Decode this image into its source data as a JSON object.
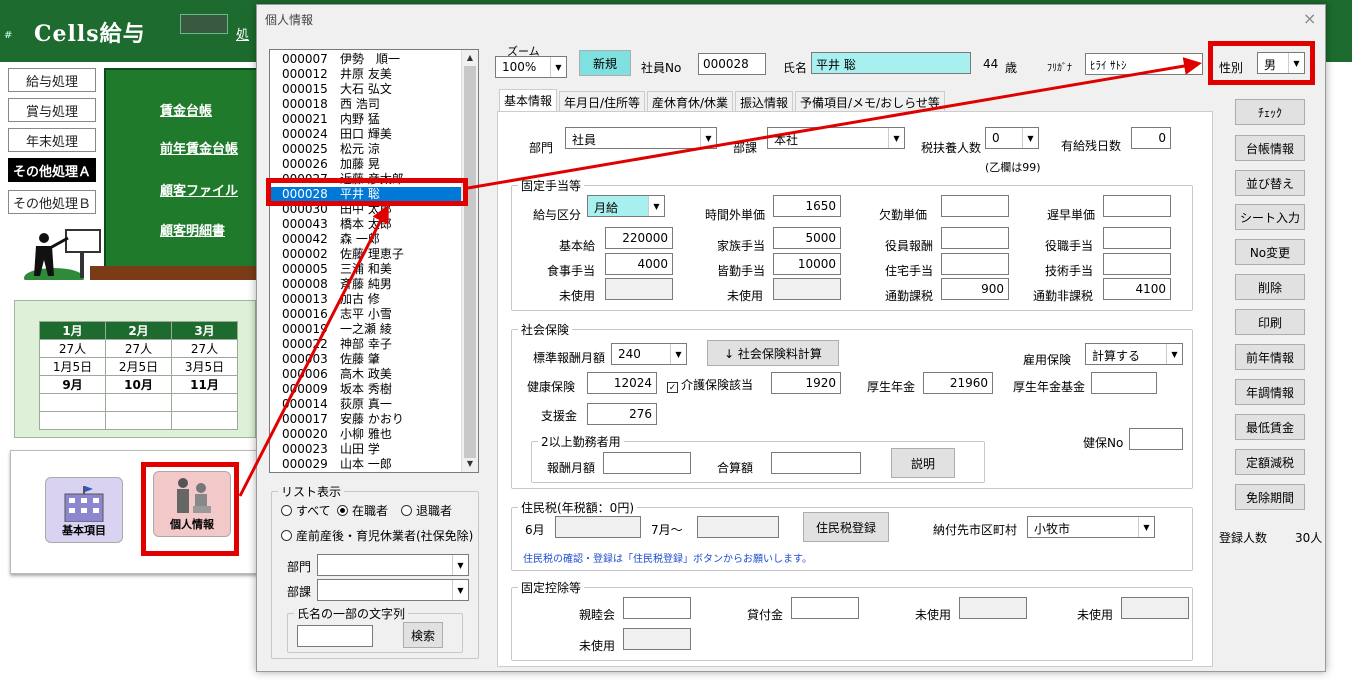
{
  "app": {
    "hash": "#",
    "title": "Cells給与",
    "header_link": "処",
    "side_menu": [
      "給与処理",
      "賞与処理",
      "年末処理",
      "その他処理Ａ",
      "その他処理Ｂ"
    ],
    "green_links": [
      "賃金台帳",
      "前年賃金台帳",
      "顧客ファイル",
      "顧客明細書"
    ],
    "months": {
      "headers": [
        "1月",
        "2月",
        "3月"
      ],
      "counts": [
        "27人",
        "27人",
        "27人"
      ],
      "dates": [
        "1月5日",
        "2月5日",
        "3月5日"
      ],
      "months2": [
        "9月",
        "10月",
        "11月"
      ]
    },
    "icons": {
      "kihon": "基本項目",
      "kojin": "個人情報"
    }
  },
  "dialog": {
    "title": "個人情報",
    "close": "×",
    "employees": [
      {
        "no": "000007",
        "name": "伊勢　順一"
      },
      {
        "no": "000012",
        "name": "井原 友美"
      },
      {
        "no": "000015",
        "name": "大石 弘文"
      },
      {
        "no": "000018",
        "name": "西 浩司"
      },
      {
        "no": "000021",
        "name": "内野 猛"
      },
      {
        "no": "000024",
        "name": "田口 輝美"
      },
      {
        "no": "000025",
        "name": "松元 涼"
      },
      {
        "no": "000026",
        "name": "加藤 晃"
      },
      {
        "no": "000027",
        "name": "近藤 彦太郎"
      },
      {
        "no": "000028",
        "name": "平井 聡"
      },
      {
        "no": "000030",
        "name": "田中 太郎"
      },
      {
        "no": "000043",
        "name": "橋本 太郎"
      },
      {
        "no": "000042",
        "name": "森 一郎"
      },
      {
        "no": "000002",
        "name": "佐藤 理恵子"
      },
      {
        "no": "000005",
        "name": "三浦 和美"
      },
      {
        "no": "000008",
        "name": "斉藤 純男"
      },
      {
        "no": "000013",
        "name": "加古 修"
      },
      {
        "no": "000016",
        "name": "志平 小雪"
      },
      {
        "no": "000019",
        "name": "一之瀬 綾"
      },
      {
        "no": "000022",
        "name": "神部 幸子"
      },
      {
        "no": "000003",
        "name": "佐藤 肇"
      },
      {
        "no": "000006",
        "name": "高木 政美"
      },
      {
        "no": "000009",
        "name": "坂本 秀樹"
      },
      {
        "no": "000014",
        "name": "荻原 真一"
      },
      {
        "no": "000017",
        "name": "安藤 かおり"
      },
      {
        "no": "000020",
        "name": "小柳 雅也"
      },
      {
        "no": "000023",
        "name": "山田 学"
      },
      {
        "no": "000029",
        "name": "山本 一郎"
      }
    ],
    "list_filter": {
      "legend": "リスト表示",
      "all": "すべて",
      "active": "在職者",
      "retired": "退職者",
      "maternity": "産前産後・育児休業者(社保免除)",
      "dept_label": "部門",
      "section_label": "部課",
      "name_part_legend": "氏名の一部の文字列",
      "search_button": "検索"
    },
    "header": {
      "zoom_label": "ズーム",
      "zoom_value": "100%",
      "new_button": "新規",
      "emp_no_label": "社員No",
      "emp_no": "000028",
      "name_label": "氏名",
      "name": "平井 聡",
      "age": "44",
      "age_unit": "歳",
      "kana_label": "ﾌﾘｶﾞﾅ",
      "kana": "ﾋﾗｲ ｻﾄｼ",
      "gender_label": "性別",
      "gender": "男"
    },
    "tabs": [
      "基本情報",
      "年月日/住所等",
      "産休育休/休業",
      "振込情報",
      "予備項目/メモ/おしらせ等"
    ],
    "basic": {
      "dept_label": "部門",
      "dept": "社員",
      "section_label": "部課",
      "section": "本社",
      "dependents_label": "税扶養人数",
      "dependents": "0",
      "dependents_note": "(乙欄は99)",
      "paid_leave_label": "有給残日数",
      "paid_leave": "0"
    },
    "fixed_allowance": {
      "legend": "固定手当等",
      "pay_type_label": "給与区分",
      "pay_type": "月給",
      "overtime_label": "時間外単価",
      "overtime": "1650",
      "absence_label": "欠勤単価",
      "absence": "",
      "late_label": "遅早単価",
      "late": "",
      "base_label": "基本給",
      "base": "220000",
      "family_label": "家族手当",
      "family": "5000",
      "officer_label": "役員報酬",
      "officer": "",
      "position_label": "役職手当",
      "position": "",
      "meal_label": "食事手当",
      "meal": "4000",
      "attendance_label": "皆勤手当",
      "attendance": "10000",
      "housing_label": "住宅手当",
      "housing": "",
      "skill_label": "技術手当",
      "skill": "",
      "unused1_label": "未使用",
      "unused2_label": "未使用",
      "commute_tax_label": "通勤課税",
      "commute_tax": "900",
      "commute_nontax_label": "通勤非課税",
      "commute_nontax": "4100"
    },
    "social": {
      "legend": "社会保険",
      "std_label": "標準報酬月額",
      "std": "240",
      "calc_button": "↓  社会保険料計算",
      "emp_ins_label": "雇用保険",
      "emp_ins": "計算する",
      "health_label": "健康保険",
      "health": "12024",
      "care_label": "介護保険該当",
      "care": "1920",
      "pension_label": "厚生年金",
      "pension": "21960",
      "pension_fund_label": "厚生年金基金",
      "pension_fund": "",
      "support_label": "支援金",
      "support": "276",
      "multi_legend": "2以上勤務者用",
      "remun_label": "報酬月額",
      "remun": "",
      "total_label": "合算額",
      "total": "",
      "explain_button": "説明",
      "health_no_label": "健保No",
      "health_no": ""
    },
    "resident": {
      "legend": "住民税(年税額：0円)",
      "june_label": "6月",
      "june": "",
      "july_label": "7月～",
      "july": "",
      "register_button": "住民税登録",
      "city_label": "納付先市区町村",
      "city": "小牧市",
      "note": "住民税の確認・登録は「住民税登録」ボタンからお願いします。"
    },
    "deduction": {
      "legend": "固定控除等",
      "social_label": "親睦会",
      "social": "",
      "loan_label": "貸付金",
      "loan": "",
      "unused1_label": "未使用",
      "unused2_label": "未使用",
      "unused3_label": "未使用"
    },
    "side_buttons": [
      "ﾁｪｯｸ",
      "台帳情報",
      "並び替え",
      "シート入力",
      "No変更",
      "削除",
      "印刷",
      "前年情報",
      "年調情報",
      "最低賃金",
      "定額減税",
      "免除期間"
    ],
    "registered_label": "登録人数",
    "registered_count": "30人"
  },
  "colors": {
    "accent_red": "#e00000",
    "selection": "#0078d7",
    "cyan": "#a8f0f0",
    "header_green": "#1d6b2e"
  }
}
